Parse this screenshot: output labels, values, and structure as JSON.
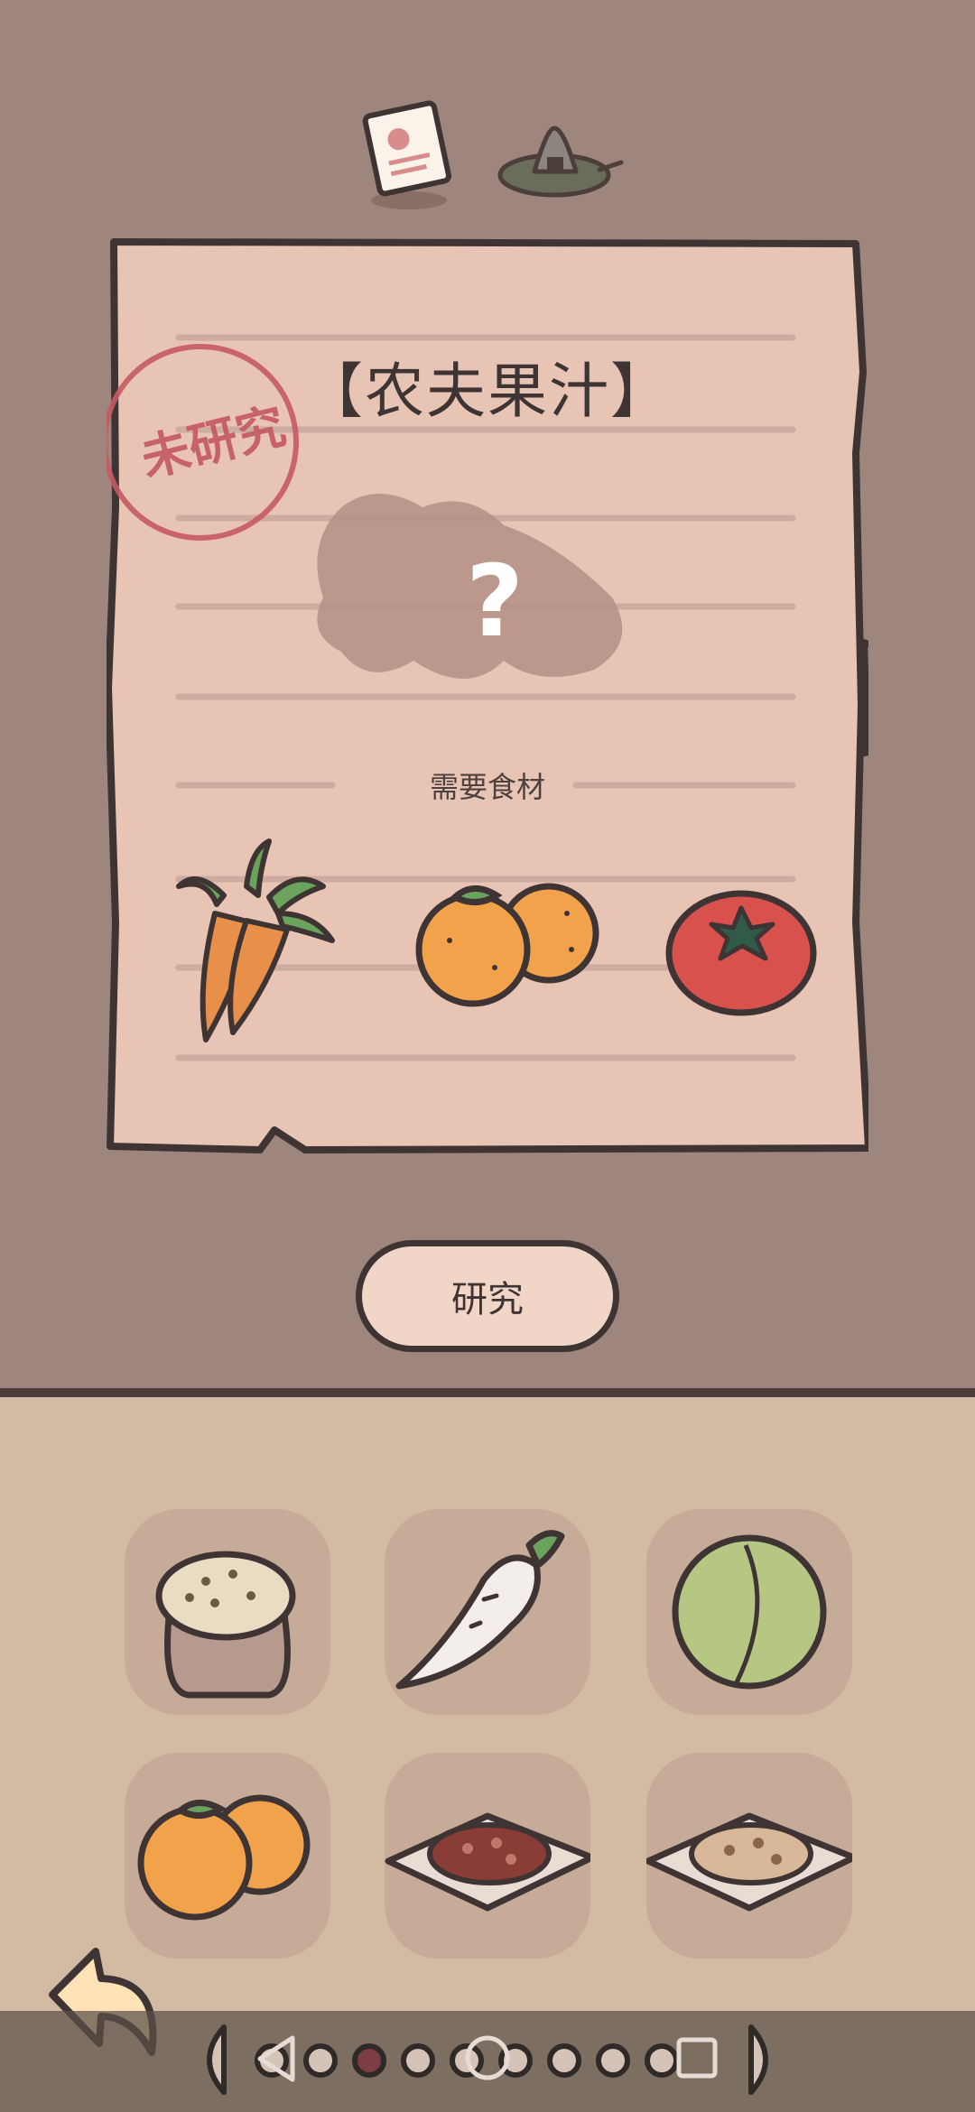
{
  "recipe": {
    "name": "【农夫果汁】",
    "stamp": "未研究",
    "ingredients_label": "需要食材",
    "unknown_mark": "?",
    "ingredients": [
      "carrot",
      "orange",
      "tomato"
    ]
  },
  "actions": {
    "research_label": "研究"
  },
  "tabs": [
    "recipe-card-tab",
    "rice-ball-tab"
  ],
  "inventory": [
    "grain-sack",
    "daikon-radish",
    "green-plum",
    "orange",
    "meat-plate",
    "bean-plate"
  ],
  "pager": {
    "total": 9,
    "active": 2
  },
  "colors": {
    "background_top": "#9e857d",
    "background_bottom": "#d3bba3",
    "paper": "#e9c6b6",
    "stamp": "#c55a63",
    "outline": "#3f3434",
    "slot": "#c6ab98"
  }
}
